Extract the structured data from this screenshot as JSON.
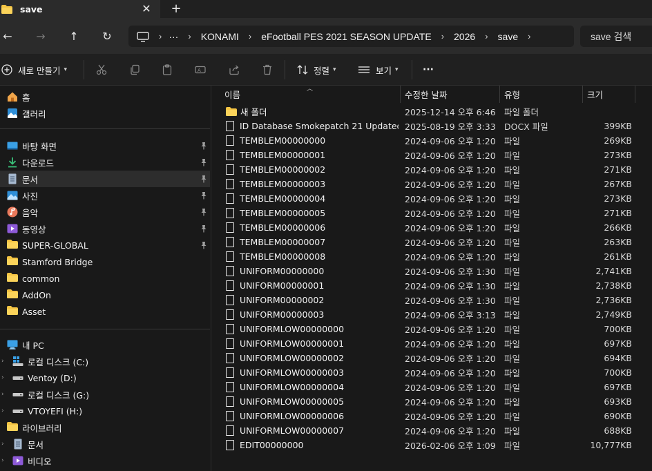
{
  "tab": {
    "title": "save",
    "close": "✕",
    "new": "+"
  },
  "nav": {
    "back": "←",
    "forward": "→",
    "up": "↑",
    "refresh": "↻"
  },
  "address": {
    "more": "···",
    "crumbs": [
      "KONAMI",
      "eFootball PES 2021 SEASON UPDATE",
      "2026",
      "save"
    ]
  },
  "search": {
    "placeholder": "save 검색"
  },
  "toolbar": {
    "new_label": "새로 만들기",
    "sort_label": "정렬",
    "view_label": "보기",
    "more_label": "···"
  },
  "sidebar": {
    "home": "홈",
    "gallery": "갤러리",
    "quick": [
      {
        "label": "바탕 화면",
        "icon": "desktop-icon",
        "pinned": true
      },
      {
        "label": "다운로드",
        "icon": "download-icon",
        "pinned": true
      },
      {
        "label": "문서",
        "icon": "document-icon",
        "pinned": true
      },
      {
        "label": "사진",
        "icon": "pictures-icon",
        "pinned": true
      },
      {
        "label": "음악",
        "icon": "music-icon",
        "pinned": true
      },
      {
        "label": "동영상",
        "icon": "video-icon",
        "pinned": true
      },
      {
        "label": "SUPER-GLOBAL",
        "icon": "folder-icon",
        "pinned": true
      },
      {
        "label": "Stamford Bridge",
        "icon": "folder-icon",
        "pinned": false
      },
      {
        "label": "common",
        "icon": "folder-icon",
        "pinned": false
      },
      {
        "label": "AddOn",
        "icon": "folder-icon",
        "pinned": false
      },
      {
        "label": "Asset",
        "icon": "folder-icon",
        "pinned": false
      }
    ],
    "this_pc": "내 PC",
    "drives": [
      {
        "label": "로컬 디스크 (C:)",
        "icon": "windows-drive-icon"
      },
      {
        "label": "Ventoy (D:)",
        "icon": "drive-icon"
      },
      {
        "label": "로컬 디스크 (G:)",
        "icon": "drive-icon"
      },
      {
        "label": "VTOYEFI (H:)",
        "icon": "drive-icon"
      }
    ],
    "libraries": "라이브러리",
    "lib_items": [
      {
        "label": "문서",
        "icon": "document-icon"
      },
      {
        "label": "비디오",
        "icon": "video-icon"
      }
    ]
  },
  "columns": {
    "name": "이름",
    "date": "수정한 날짜",
    "type": "유형",
    "size": "크기"
  },
  "files": [
    {
      "name": "새 폴더",
      "date": "2025-12-14 오후 6:46",
      "type": "파일 폴더",
      "size": "",
      "kind": "folder"
    },
    {
      "name": "ID Database Smokepatch 21 Updated,...",
      "date": "2025-08-19 오후 3:33",
      "type": "DOCX 파일",
      "size": "399KB",
      "kind": "file"
    },
    {
      "name": "TEMBLEM00000000",
      "date": "2024-09-06 오후 1:20",
      "type": "파일",
      "size": "269KB",
      "kind": "file"
    },
    {
      "name": "TEMBLEM00000001",
      "date": "2024-09-06 오후 1:20",
      "type": "파일",
      "size": "273KB",
      "kind": "file"
    },
    {
      "name": "TEMBLEM00000002",
      "date": "2024-09-06 오후 1:20",
      "type": "파일",
      "size": "271KB",
      "kind": "file"
    },
    {
      "name": "TEMBLEM00000003",
      "date": "2024-09-06 오후 1:20",
      "type": "파일",
      "size": "267KB",
      "kind": "file"
    },
    {
      "name": "TEMBLEM00000004",
      "date": "2024-09-06 오후 1:20",
      "type": "파일",
      "size": "273KB",
      "kind": "file"
    },
    {
      "name": "TEMBLEM00000005",
      "date": "2024-09-06 오후 1:20",
      "type": "파일",
      "size": "271KB",
      "kind": "file"
    },
    {
      "name": "TEMBLEM00000006",
      "date": "2024-09-06 오후 1:20",
      "type": "파일",
      "size": "266KB",
      "kind": "file"
    },
    {
      "name": "TEMBLEM00000007",
      "date": "2024-09-06 오후 1:20",
      "type": "파일",
      "size": "263KB",
      "kind": "file"
    },
    {
      "name": "TEMBLEM00000008",
      "date": "2024-09-06 오후 1:20",
      "type": "파일",
      "size": "261KB",
      "kind": "file"
    },
    {
      "name": "UNIFORM00000000",
      "date": "2024-09-06 오후 1:30",
      "type": "파일",
      "size": "2,741KB",
      "kind": "file"
    },
    {
      "name": "UNIFORM00000001",
      "date": "2024-09-06 오후 1:30",
      "type": "파일",
      "size": "2,738KB",
      "kind": "file"
    },
    {
      "name": "UNIFORM00000002",
      "date": "2024-09-06 오후 1:30",
      "type": "파일",
      "size": "2,736KB",
      "kind": "file"
    },
    {
      "name": "UNIFORM00000003",
      "date": "2024-09-06 오후 3:13",
      "type": "파일",
      "size": "2,749KB",
      "kind": "file"
    },
    {
      "name": "UNIFORMLOW00000000",
      "date": "2024-09-06 오후 1:20",
      "type": "파일",
      "size": "700KB",
      "kind": "file"
    },
    {
      "name": "UNIFORMLOW00000001",
      "date": "2024-09-06 오후 1:20",
      "type": "파일",
      "size": "697KB",
      "kind": "file"
    },
    {
      "name": "UNIFORMLOW00000002",
      "date": "2024-09-06 오후 1:20",
      "type": "파일",
      "size": "694KB",
      "kind": "file"
    },
    {
      "name": "UNIFORMLOW00000003",
      "date": "2024-09-06 오후 1:20",
      "type": "파일",
      "size": "700KB",
      "kind": "file"
    },
    {
      "name": "UNIFORMLOW00000004",
      "date": "2024-09-06 오후 1:20",
      "type": "파일",
      "size": "697KB",
      "kind": "file"
    },
    {
      "name": "UNIFORMLOW00000005",
      "date": "2024-09-06 오후 1:20",
      "type": "파일",
      "size": "693KB",
      "kind": "file"
    },
    {
      "name": "UNIFORMLOW00000006",
      "date": "2024-09-06 오후 1:20",
      "type": "파일",
      "size": "690KB",
      "kind": "file"
    },
    {
      "name": "UNIFORMLOW00000007",
      "date": "2024-09-06 오후 1:20",
      "type": "파일",
      "size": "688KB",
      "kind": "file"
    },
    {
      "name": "EDIT00000000",
      "date": "2026-02-06 오후 1:09",
      "type": "파일",
      "size": "10,777KB",
      "kind": "file"
    }
  ],
  "colors": {
    "accent": "#4cc2ff",
    "folder": "#f4c443",
    "background": "#191919",
    "chrome": "#2b2b2b"
  }
}
